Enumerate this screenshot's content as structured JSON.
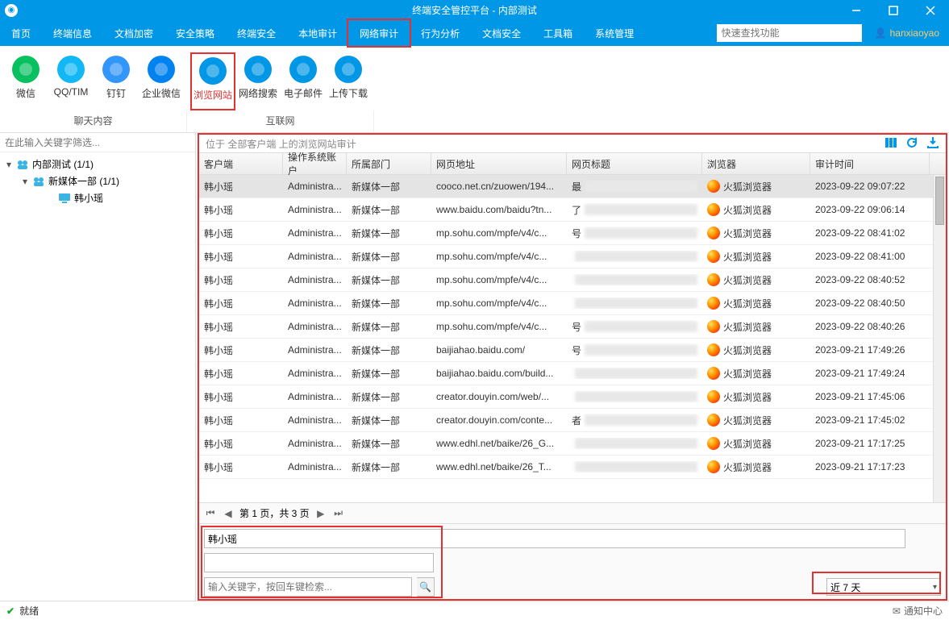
{
  "window": {
    "title": "终端安全管控平台 - 内部测试"
  },
  "menu": {
    "items": [
      "首页",
      "终端信息",
      "文档加密",
      "安全策略",
      "终端安全",
      "本地审计",
      "网络审计",
      "行为分析",
      "文档安全",
      "工具箱",
      "系统管理"
    ],
    "active_index": 6,
    "search_placeholder": "快速查找功能",
    "user": "hanxiaoyao"
  },
  "toolbar": {
    "groups": [
      {
        "label": "聊天内容",
        "items": [
          {
            "label": "微信",
            "color": "#07C160"
          },
          {
            "label": "QQ/TIM",
            "color": "#12B7F5"
          },
          {
            "label": "钉钉",
            "color": "#3296FA"
          },
          {
            "label": "企业微信",
            "color": "#0082EF"
          }
        ]
      },
      {
        "label": "互联网",
        "items": [
          {
            "label": "浏览网站",
            "color": "#0097e6",
            "active": true
          },
          {
            "label": "网络搜索",
            "color": "#0097e6"
          },
          {
            "label": "电子邮件",
            "color": "#0097e6"
          },
          {
            "label": "上传下载",
            "color": "#0097e6"
          }
        ]
      }
    ]
  },
  "sidebar": {
    "filter_placeholder": "在此输入关键字筛选...",
    "nodes": [
      {
        "level": 0,
        "twisty": "▾",
        "label": "内部测试 (1/1)",
        "icon": "group"
      },
      {
        "level": 1,
        "twisty": "▾",
        "label": "新媒体一部 (1/1)",
        "icon": "group"
      },
      {
        "level": 2,
        "twisty": "",
        "label": "韩小瑶",
        "icon": "pc"
      }
    ]
  },
  "crumb": "位于 全部客户端 上的浏览网站审计",
  "columns": [
    "客户端",
    "操作系统账户",
    "所属部门",
    "网页地址",
    "网页标题",
    "浏览器",
    "审计时间"
  ],
  "rows": [
    {
      "c": "韩小瑶",
      "a": "Administra...",
      "d": "新媒体一部",
      "u": "cooco.net.cn/zuowen/194...",
      "t": "最",
      "b": "火狐浏览器",
      "ts": "2023-09-22 09:07:22",
      "sel": true
    },
    {
      "c": "韩小瑶",
      "a": "Administra...",
      "d": "新媒体一部",
      "u": "www.baidu.com/baidu?tn...",
      "t": "了",
      "b": "火狐浏览器",
      "ts": "2023-09-22 09:06:14"
    },
    {
      "c": "韩小瑶",
      "a": "Administra...",
      "d": "新媒体一部",
      "u": "mp.sohu.com/mpfe/v4/c...",
      "t": "号",
      "b": "火狐浏览器",
      "ts": "2023-09-22 08:41:02"
    },
    {
      "c": "韩小瑶",
      "a": "Administra...",
      "d": "新媒体一部",
      "u": "mp.sohu.com/mpfe/v4/c...",
      "t": "",
      "b": "火狐浏览器",
      "ts": "2023-09-22 08:41:00"
    },
    {
      "c": "韩小瑶",
      "a": "Administra...",
      "d": "新媒体一部",
      "u": "mp.sohu.com/mpfe/v4/c...",
      "t": "",
      "b": "火狐浏览器",
      "ts": "2023-09-22 08:40:52"
    },
    {
      "c": "韩小瑶",
      "a": "Administra...",
      "d": "新媒体一部",
      "u": "mp.sohu.com/mpfe/v4/c...",
      "t": "",
      "b": "火狐浏览器",
      "ts": "2023-09-22 08:40:50"
    },
    {
      "c": "韩小瑶",
      "a": "Administra...",
      "d": "新媒体一部",
      "u": "mp.sohu.com/mpfe/v4/c...",
      "t": "号",
      "b": "火狐浏览器",
      "ts": "2023-09-22 08:40:26"
    },
    {
      "c": "韩小瑶",
      "a": "Administra...",
      "d": "新媒体一部",
      "u": "baijiahao.baidu.com/",
      "t": "号",
      "b": "火狐浏览器",
      "ts": "2023-09-21 17:49:26"
    },
    {
      "c": "韩小瑶",
      "a": "Administra...",
      "d": "新媒体一部",
      "u": "baijiahao.baidu.com/build...",
      "t": "",
      "b": "火狐浏览器",
      "ts": "2023-09-21 17:49:24"
    },
    {
      "c": "韩小瑶",
      "a": "Administra...",
      "d": "新媒体一部",
      "u": "creator.douyin.com/web/...",
      "t": "",
      "b": "火狐浏览器",
      "ts": "2023-09-21 17:45:06"
    },
    {
      "c": "韩小瑶",
      "a": "Administra...",
      "d": "新媒体一部",
      "u": "creator.douyin.com/conte...",
      "t": "者",
      "b": "火狐浏览器",
      "ts": "2023-09-21 17:45:02"
    },
    {
      "c": "韩小瑶",
      "a": "Administra...",
      "d": "新媒体一部",
      "u": "www.edhl.net/baike/26_G...",
      "t": "",
      "b": "火狐浏览器",
      "ts": "2023-09-21 17:17:25"
    },
    {
      "c": "韩小瑶",
      "a": "Administra...",
      "d": "新媒体一部",
      "u": "www.edhl.net/baike/26_T...",
      "t": "",
      "b": "火狐浏览器",
      "ts": "2023-09-21 17:17:23"
    }
  ],
  "pager": {
    "text": "第 1 页，共 3 页"
  },
  "bottom": {
    "client": "韩小瑶",
    "keyword_placeholder": "输入关键字，按回车键检索...",
    "range": "近 7 天"
  },
  "status": {
    "text": "就绪",
    "right": "通知中心"
  }
}
